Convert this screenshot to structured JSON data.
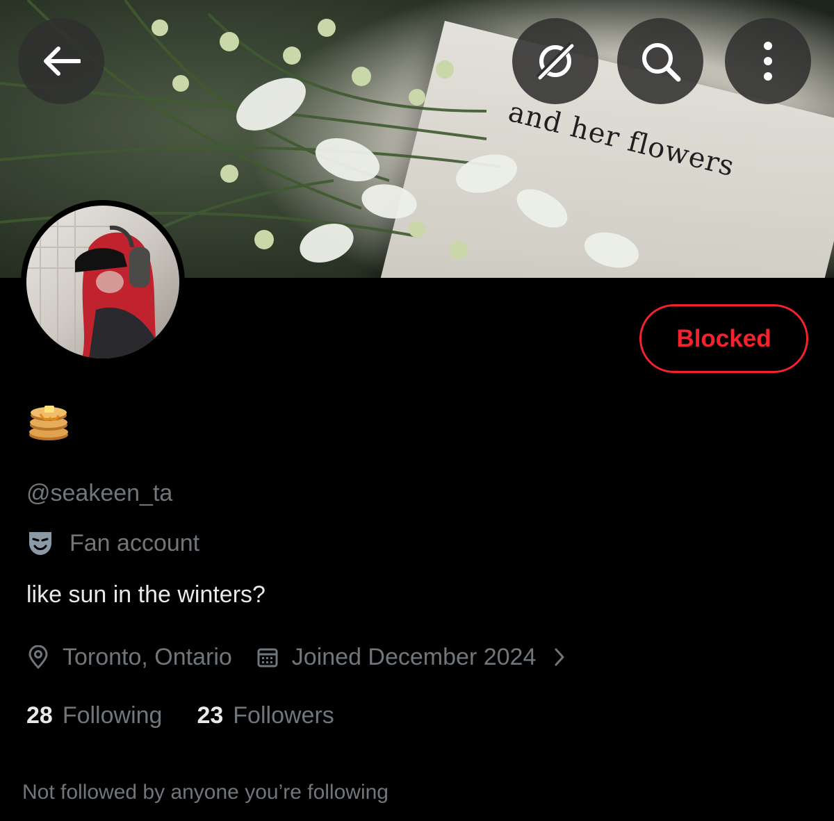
{
  "banner": {
    "book_title": "and her flowers"
  },
  "top_bar": {
    "back_icon": "arrow-left-icon",
    "grok_icon": "grok-icon",
    "search_icon": "search-icon",
    "more_icon": "more-vertical-icon"
  },
  "profile": {
    "display_name_emoji": "🥞",
    "handle": "@seakeen_ta",
    "category_icon": "theater-mask-icon",
    "category": "Fan account",
    "bio": "like sun in the winters?",
    "location_icon": "location-pin-icon",
    "location": "Toronto, Ontario",
    "joined_icon": "calendar-icon",
    "joined": "Joined December 2024",
    "following_count": "28",
    "following_label": "Following",
    "followers_count": "23",
    "followers_label": "Followers",
    "mutuals_text": "Not followed by anyone you’re following"
  },
  "actions": {
    "blocked_label": "Blocked"
  },
  "colors": {
    "background": "#000000",
    "blocked_red": "#f4212e",
    "muted_text": "#71767b",
    "primary_text": "#e7e9ea"
  }
}
